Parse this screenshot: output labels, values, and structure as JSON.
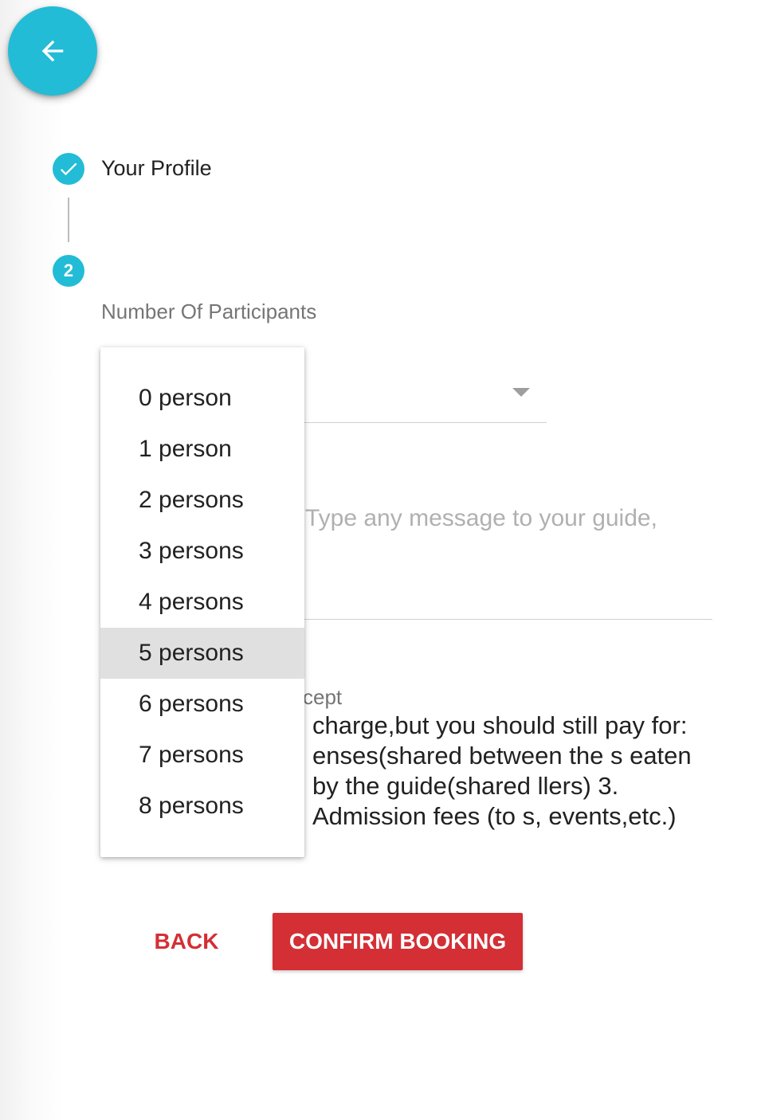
{
  "header": {
    "back_icon": "arrow-left-icon",
    "accent_color": "#22bcd6"
  },
  "stepper": {
    "step1": {
      "label": "Your Profile",
      "icon": "check-icon",
      "status": "completed"
    },
    "step2": {
      "number": "2",
      "status": "active"
    }
  },
  "form": {
    "participants_label": "Number Of Participants",
    "message_placeholder": "Type any message to your guide,",
    "terms_label": "cept",
    "terms_text": "charge,but you should still pay for: enses(shared between the s eaten by the guide(shared llers) 3. Admission fees (to s, events,etc.)"
  },
  "dropdown": {
    "options": [
      "0 person",
      "1 person",
      "2 persons",
      "3 persons",
      "4 persons",
      "5 persons",
      "6 persons",
      "7 persons",
      "8 persons"
    ],
    "highlighted": "5 persons"
  },
  "actions": {
    "back_label": "BACK",
    "confirm_label": "CONFIRM BOOKING",
    "primary_color": "#d32f35"
  }
}
